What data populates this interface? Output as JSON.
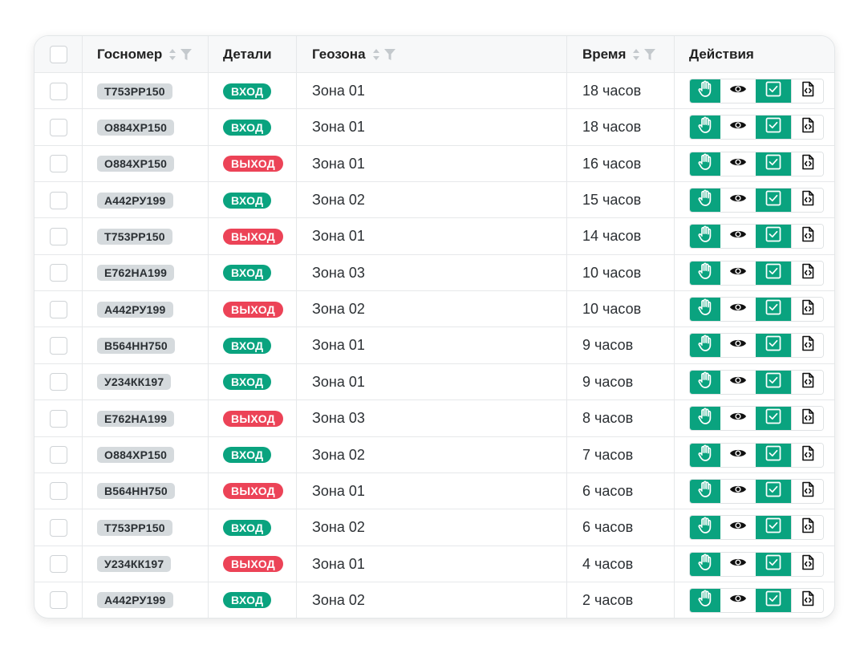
{
  "header": {
    "plate": "Госномер",
    "details": "Детали",
    "zone": "Геозона",
    "time": "Время",
    "actions": "Действия"
  },
  "colors": {
    "accent_green": "#0aa37f",
    "exit_red": "#ec4357",
    "plate_bg": "#d5dadd"
  },
  "icons": {
    "sort": "sort-icon",
    "filter": "filter-icon",
    "hand": "hand-icon",
    "eye": "eye-icon",
    "check": "checkbox-check-icon",
    "code": "code-file-icon"
  },
  "rows": [
    {
      "plate": "Т753РР150",
      "detail": "ВХОД",
      "dir": "in",
      "zone": "Зона 01",
      "time": "18 часов"
    },
    {
      "plate": "О884ХР150",
      "detail": "ВХОД",
      "dir": "in",
      "zone": "Зона 01",
      "time": "18 часов"
    },
    {
      "plate": "О884ХР150",
      "detail": "ВЫХОД",
      "dir": "out",
      "zone": "Зона 01",
      "time": "16 часов"
    },
    {
      "plate": "А442РУ199",
      "detail": "ВХОД",
      "dir": "in",
      "zone": "Зона 02",
      "time": "15 часов"
    },
    {
      "plate": "Т753РР150",
      "detail": "ВЫХОД",
      "dir": "out",
      "zone": "Зона 01",
      "time": "14 часов"
    },
    {
      "plate": "Е762НА199",
      "detail": "ВХОД",
      "dir": "in",
      "zone": "Зона 03",
      "time": "10 часов"
    },
    {
      "plate": "А442РУ199",
      "detail": "ВЫХОД",
      "dir": "out",
      "zone": "Зона 02",
      "time": "10 часов"
    },
    {
      "plate": "В564НН750",
      "detail": "ВХОД",
      "dir": "in",
      "zone": "Зона 01",
      "time": "9 часов"
    },
    {
      "plate": "У234КК197",
      "detail": "ВХОД",
      "dir": "in",
      "zone": "Зона 01",
      "time": "9 часов"
    },
    {
      "plate": "Е762НА199",
      "detail": "ВЫХОД",
      "dir": "out",
      "zone": "Зона 03",
      "time": "8 часов"
    },
    {
      "plate": "О884ХР150",
      "detail": "ВХОД",
      "dir": "in",
      "zone": "Зона 02",
      "time": "7 часов"
    },
    {
      "plate": "В564НН750",
      "detail": "ВЫХОД",
      "dir": "out",
      "zone": "Зона 01",
      "time": "6 часов"
    },
    {
      "plate": "Т753РР150",
      "detail": "ВХОД",
      "dir": "in",
      "zone": "Зона 02",
      "time": "6 часов"
    },
    {
      "plate": "У234КК197",
      "detail": "ВЫХОД",
      "dir": "out",
      "zone": "Зона 01",
      "time": "4 часов"
    },
    {
      "plate": "А442РУ199",
      "detail": "ВХОД",
      "dir": "in",
      "zone": "Зона 02",
      "time": "2 часов"
    }
  ]
}
